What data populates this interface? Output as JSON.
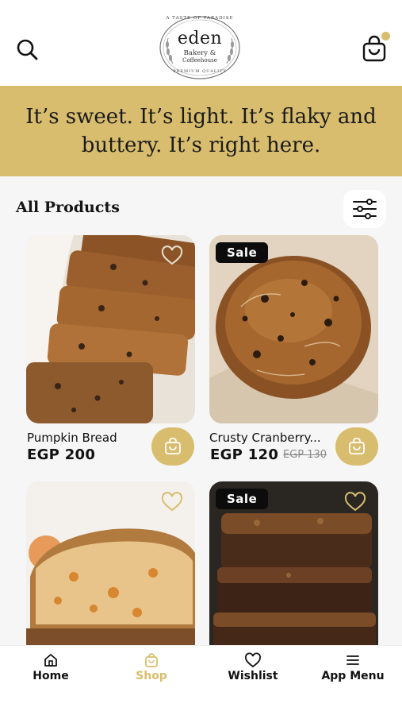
{
  "header": {
    "logo": {
      "arc_top": "A TASTE OF PARADISE",
      "name": "eden",
      "line1": "Bakery &",
      "line2": "Coffeehouse",
      "arc_bottom": "PREMIUM QUALITY"
    },
    "icons": {
      "search": "search-icon",
      "cart": "cart-icon"
    },
    "cart_indicator_color": "#d8bd6e"
  },
  "banner": {
    "text": "It’s sweet. It’s light. It’s flaky and buttery. It’s right here.",
    "background": "#d8bd6e"
  },
  "products_section": {
    "title": "All Products",
    "filter_icon": "filter-sliders-icon",
    "items": [
      {
        "name": "Pumpkin Bread",
        "price": "EGP 200",
        "old_price": "",
        "sale": false,
        "wishlist_icon": "heart-icon"
      },
      {
        "name": "Crusty Cranberry...",
        "price": "EGP 120",
        "old_price": "EGP 130",
        "sale": true,
        "sale_label": "Sale",
        "wishlist_icon": "heart-icon"
      },
      {
        "name": "",
        "price": "",
        "old_price": "",
        "sale": false,
        "wishlist_icon": "heart-icon"
      },
      {
        "name": "",
        "price": "",
        "old_price": "",
        "sale": true,
        "sale_label": "Sale",
        "wishlist_icon": "heart-icon"
      }
    ]
  },
  "bottom_nav": {
    "items": [
      {
        "label": "Home",
        "icon": "home-icon",
        "active": false
      },
      {
        "label": "Shop",
        "icon": "shop-bag-icon",
        "active": true
      },
      {
        "label": "Wishlist",
        "icon": "heart-icon",
        "active": false
      },
      {
        "label": "App Menu",
        "icon": "menu-icon",
        "active": false
      }
    ],
    "active_color": "#d8bd6e"
  }
}
